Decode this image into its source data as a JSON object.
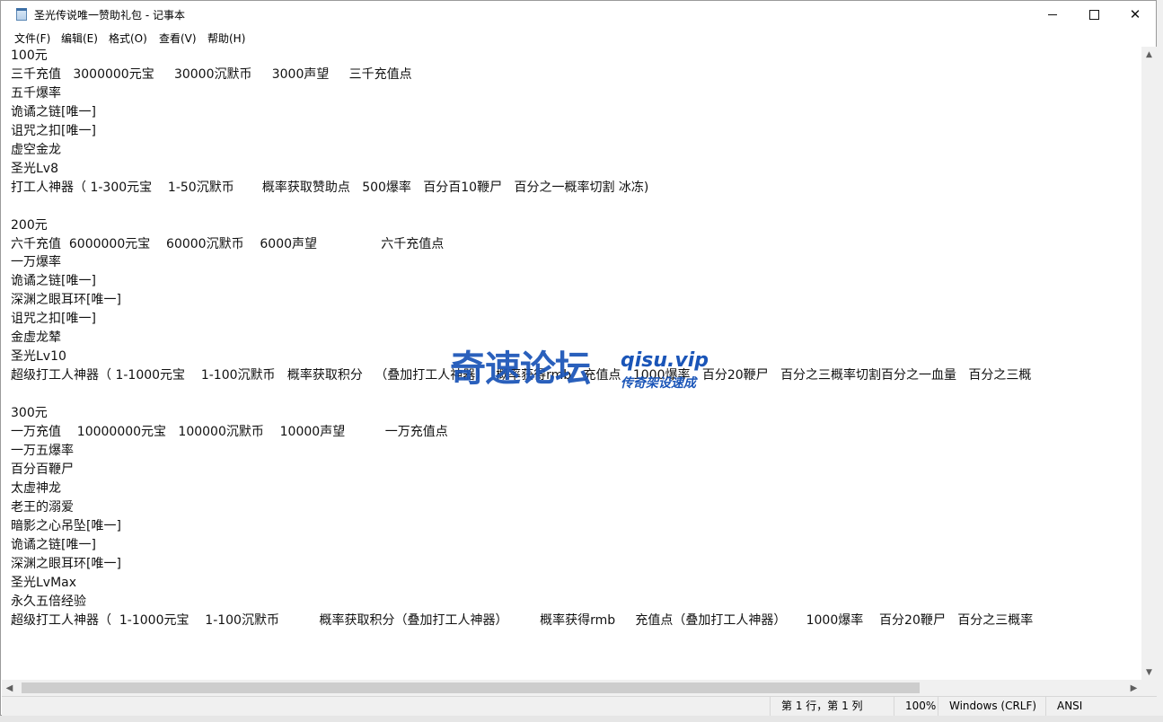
{
  "window": {
    "title": "圣光传说唯一赞助礼包 - 记事本",
    "minimize_glyph": "",
    "maximize_glyph": "",
    "close_glyph": "✕"
  },
  "menu": [
    {
      "label": "文件(F)"
    },
    {
      "label": "编辑(E)"
    },
    {
      "label": "格式(O)"
    },
    {
      "label": "查看(V)"
    },
    {
      "label": "帮助(H)"
    }
  ],
  "document": {
    "lines": [
      "100元",
      "三千充值   3000000元宝     30000沉默币     3000声望     三千充值点",
      "五千爆率",
      "诡谲之链[唯一]",
      "诅咒之扣[唯一]",
      "虚空金龙",
      "圣光Lv8",
      "打工人神器（ 1-300元宝    1-50沉默币       概率获取赞助点   500爆率   百分百10鞭尸   百分之一概率切割 冰冻)",
      "",
      "200元",
      "六千充值  6000000元宝    60000沉默币    6000声望                六千充值点",
      "一万爆率",
      "诡谲之链[唯一]",
      "深渊之眼耳环[唯一]",
      "诅咒之扣[唯一]",
      "金虚龙辇",
      "圣光Lv10",
      "超级打工人神器（ 1-1000元宝    1-100沉默币   概率获取积分   （叠加打工人神器）  概率获得rmb   充值点   1000爆率   百分20鞭尸   百分之三概率切割百分之一血量   百分之三概",
      "",
      "300元",
      "一万充值    10000000元宝   100000沉默币    10000声望          一万充值点",
      "一万五爆率",
      "百分百鞭尸",
      "太虚神龙",
      "老王的溺爱",
      "暗影之心吊坠[唯一]",
      "诡谲之链[唯一]",
      "深渊之眼耳环[唯一]",
      "圣光LvMax",
      "永久五倍经验",
      "超级打工人神器（  1-1000元宝    1-100沉默币          概率获取积分（叠加打工人神器）        概率获得rmb     充值点（叠加打工人神器）     1000爆率    百分20鞭尸   百分之三概率"
    ]
  },
  "scrollbars": {
    "up_arrow": "▲",
    "down_arrow": "▼",
    "left_arrow": "◀",
    "right_arrow": "▶"
  },
  "statusbar": {
    "position": "第 1 行，第 1 列",
    "zoom": "100%",
    "line_ending": "Windows (CRLF)",
    "encoding": "ANSI"
  },
  "watermark": {
    "name": "奇速论坛",
    "domain": "qisu.vip",
    "slogan": "传奇架设速成"
  }
}
